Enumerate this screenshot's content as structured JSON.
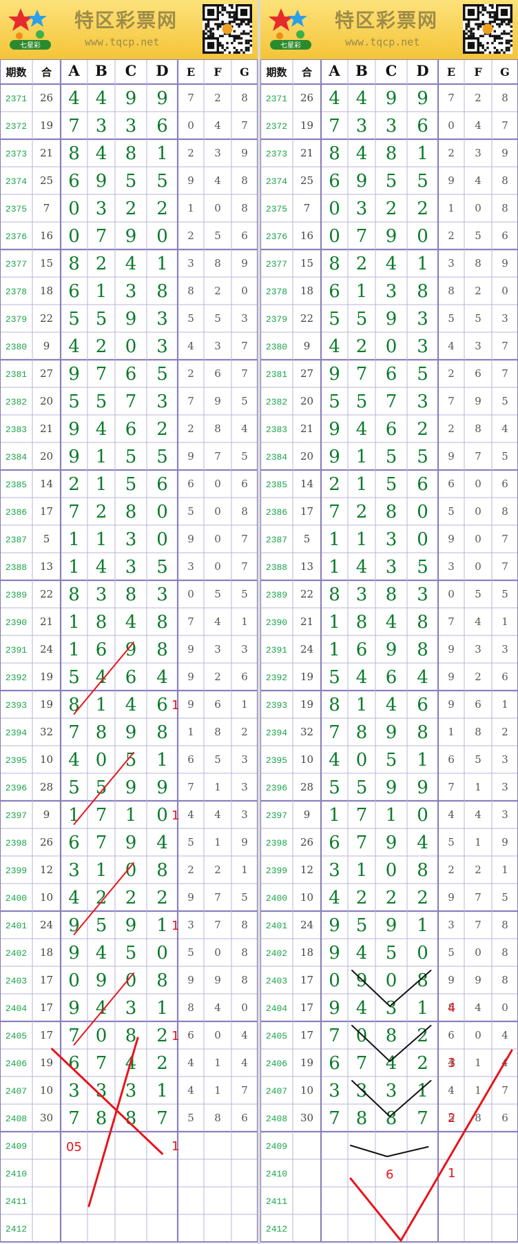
{
  "site": {
    "title": "特区彩票网",
    "url": "www.tqcp.net",
    "logo_text": "七星彩"
  },
  "headers": [
    "期数",
    "合",
    "A",
    "B",
    "C",
    "D",
    "E",
    "F",
    "G"
  ],
  "rows": [
    {
      "p": "2371",
      "s": "26",
      "d": [
        "4",
        "4",
        "9",
        "9",
        "7",
        "2",
        "8"
      ]
    },
    {
      "p": "2372",
      "s": "19",
      "d": [
        "7",
        "3",
        "3",
        "6",
        "0",
        "4",
        "7"
      ]
    },
    {
      "p": "2373",
      "s": "21",
      "d": [
        "8",
        "4",
        "8",
        "1",
        "2",
        "3",
        "9"
      ]
    },
    {
      "p": "2374",
      "s": "25",
      "d": [
        "6",
        "9",
        "5",
        "5",
        "9",
        "4",
        "8"
      ]
    },
    {
      "p": "2375",
      "s": "7",
      "d": [
        "0",
        "3",
        "2",
        "2",
        "1",
        "0",
        "8"
      ]
    },
    {
      "p": "2376",
      "s": "16",
      "d": [
        "0",
        "7",
        "9",
        "0",
        "2",
        "5",
        "6"
      ]
    },
    {
      "p": "2377",
      "s": "15",
      "d": [
        "8",
        "2",
        "4",
        "1",
        "3",
        "8",
        "9"
      ]
    },
    {
      "p": "2378",
      "s": "18",
      "d": [
        "6",
        "1",
        "3",
        "8",
        "8",
        "2",
        "0"
      ]
    },
    {
      "p": "2379",
      "s": "22",
      "d": [
        "5",
        "5",
        "9",
        "3",
        "5",
        "5",
        "3"
      ]
    },
    {
      "p": "2380",
      "s": "9",
      "d": [
        "4",
        "2",
        "0",
        "3",
        "4",
        "3",
        "7"
      ]
    },
    {
      "p": "2381",
      "s": "27",
      "d": [
        "9",
        "7",
        "6",
        "5",
        "2",
        "6",
        "7"
      ]
    },
    {
      "p": "2382",
      "s": "20",
      "d": [
        "5",
        "5",
        "7",
        "3",
        "7",
        "9",
        "5"
      ]
    },
    {
      "p": "2383",
      "s": "21",
      "d": [
        "9",
        "4",
        "6",
        "2",
        "2",
        "8",
        "4"
      ]
    },
    {
      "p": "2384",
      "s": "20",
      "d": [
        "9",
        "1",
        "5",
        "5",
        "9",
        "7",
        "5"
      ]
    },
    {
      "p": "2385",
      "s": "14",
      "d": [
        "2",
        "1",
        "5",
        "6",
        "6",
        "0",
        "6"
      ]
    },
    {
      "p": "2386",
      "s": "17",
      "d": [
        "7",
        "2",
        "8",
        "0",
        "5",
        "0",
        "8"
      ]
    },
    {
      "p": "2387",
      "s": "5",
      "d": [
        "1",
        "1",
        "3",
        "0",
        "9",
        "0",
        "7"
      ]
    },
    {
      "p": "2388",
      "s": "13",
      "d": [
        "1",
        "4",
        "3",
        "5",
        "3",
        "0",
        "7"
      ]
    },
    {
      "p": "2389",
      "s": "22",
      "d": [
        "8",
        "3",
        "8",
        "3",
        "0",
        "5",
        "5"
      ]
    },
    {
      "p": "2390",
      "s": "21",
      "d": [
        "1",
        "8",
        "4",
        "8",
        "7",
        "4",
        "1"
      ]
    },
    {
      "p": "2391",
      "s": "24",
      "d": [
        "1",
        "6",
        "9",
        "8",
        "9",
        "3",
        "3"
      ]
    },
    {
      "p": "2392",
      "s": "19",
      "d": [
        "5",
        "4",
        "6",
        "4",
        "9",
        "2",
        "6"
      ]
    },
    {
      "p": "2393",
      "s": "19",
      "d": [
        "8",
        "1",
        "4",
        "6",
        "9",
        "6",
        "1"
      ]
    },
    {
      "p": "2394",
      "s": "32",
      "d": [
        "7",
        "8",
        "9",
        "8",
        "1",
        "8",
        "2"
      ]
    },
    {
      "p": "2395",
      "s": "10",
      "d": [
        "4",
        "0",
        "5",
        "1",
        "6",
        "5",
        "3"
      ]
    },
    {
      "p": "2396",
      "s": "28",
      "d": [
        "5",
        "5",
        "9",
        "9",
        "7",
        "1",
        "3"
      ]
    },
    {
      "p": "2397",
      "s": "9",
      "d": [
        "1",
        "7",
        "1",
        "0",
        "4",
        "4",
        "3"
      ]
    },
    {
      "p": "2398",
      "s": "26",
      "d": [
        "6",
        "7",
        "9",
        "4",
        "5",
        "1",
        "9"
      ]
    },
    {
      "p": "2399",
      "s": "12",
      "d": [
        "3",
        "1",
        "0",
        "8",
        "2",
        "2",
        "1"
      ]
    },
    {
      "p": "2400",
      "s": "10",
      "d": [
        "4",
        "2",
        "2",
        "2",
        "9",
        "7",
        "5"
      ]
    },
    {
      "p": "2401",
      "s": "24",
      "d": [
        "9",
        "5",
        "9",
        "1",
        "3",
        "7",
        "8"
      ]
    },
    {
      "p": "2402",
      "s": "18",
      "d": [
        "9",
        "4",
        "5",
        "0",
        "5",
        "0",
        "8"
      ]
    },
    {
      "p": "2403",
      "s": "17",
      "d": [
        "0",
        "9",
        "0",
        "8",
        "9",
        "9",
        "8"
      ]
    },
    {
      "p": "2404",
      "s": "17",
      "d": [
        "9",
        "4",
        "3",
        "1",
        "8",
        "4",
        "0"
      ]
    },
    {
      "p": "2405",
      "s": "17",
      "d": [
        "7",
        "0",
        "8",
        "2",
        "6",
        "0",
        "4"
      ]
    },
    {
      "p": "2406",
      "s": "19",
      "d": [
        "6",
        "7",
        "4",
        "2",
        "4",
        "1",
        "4"
      ]
    },
    {
      "p": "2407",
      "s": "10",
      "d": [
        "3",
        "3",
        "3",
        "1",
        "4",
        "1",
        "7"
      ]
    },
    {
      "p": "2408",
      "s": "30",
      "d": [
        "7",
        "8",
        "8",
        "7",
        "5",
        "8",
        "6"
      ]
    },
    {
      "p": "2409",
      "s": "",
      "d": [
        "",
        "",
        "",
        "",
        "",
        "",
        ""
      ]
    },
    {
      "p": "2410",
      "s": "",
      "d": [
        "",
        "",
        "",
        "",
        "",
        "",
        ""
      ]
    },
    {
      "p": "2411",
      "s": "",
      "d": [
        "",
        "",
        "",
        "",
        "",
        "",
        ""
      ]
    },
    {
      "p": "2412",
      "s": "",
      "d": [
        "",
        "",
        "",
        "",
        "",
        "",
        ""
      ]
    }
  ],
  "annotations": {
    "left": {
      "ones": [
        "1",
        "1",
        "1",
        "1",
        "1"
      ],
      "note": "05"
    },
    "right": {
      "seq": [
        "4",
        "3",
        "2",
        "1"
      ],
      "note": "6"
    }
  },
  "colors": {
    "accent_green": "#0a7a2a",
    "period_green": "#1aa34a",
    "grid": "#8b7fbf",
    "grid_light": "#b9b3d8",
    "annotation_red": "#e8141a"
  }
}
